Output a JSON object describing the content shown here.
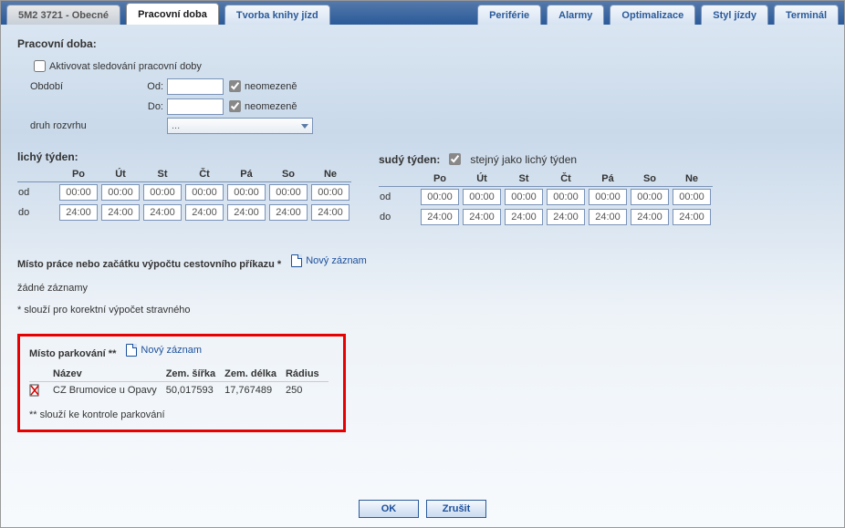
{
  "tabs": [
    {
      "label": "5M2 3721 - Obecné"
    },
    {
      "label": "Pracovní doba"
    },
    {
      "label": "Tvorba knihy jízd"
    },
    {
      "label": "Periférie"
    },
    {
      "label": "Alarmy"
    },
    {
      "label": "Optimalizace"
    },
    {
      "label": "Styl jízdy"
    },
    {
      "label": "Terminál"
    }
  ],
  "workhours": {
    "heading": "Pracovní doba:",
    "activate_label": "Aktivovat sledování pracovní doby",
    "period_label": "Období",
    "from_label": "Od:",
    "to_label": "Do:",
    "from_value": "",
    "to_value": "",
    "unlimited_label": "neomezeně",
    "schedule_type_label": "druh rozvrhu",
    "schedule_type_value": "..."
  },
  "odd_week": {
    "title": "lichý týden:",
    "days": [
      "Po",
      "Út",
      "St",
      "Čt",
      "Pá",
      "So",
      "Ne"
    ],
    "row_od": "od",
    "row_do": "do",
    "od": [
      "00:00",
      "00:00",
      "00:00",
      "00:00",
      "00:00",
      "00:00",
      "00:00"
    ],
    "do": [
      "24:00",
      "24:00",
      "24:00",
      "24:00",
      "24:00",
      "24:00",
      "24:00"
    ]
  },
  "even_week": {
    "title": "sudý týden:",
    "same_label": "stejný jako lichý týden",
    "days": [
      "Po",
      "Út",
      "St",
      "Čt",
      "Pá",
      "So",
      "Ne"
    ],
    "row_od": "od",
    "row_do": "do",
    "od": [
      "00:00",
      "00:00",
      "00:00",
      "00:00",
      "00:00",
      "00:00",
      "00:00"
    ],
    "do": [
      "24:00",
      "24:00",
      "24:00",
      "24:00",
      "24:00",
      "24:00",
      "24:00"
    ]
  },
  "workplace": {
    "heading": "Místo práce nebo začátku výpočtu cestovního příkazu *",
    "new_link": "Nový záznam",
    "empty": "žádné záznamy",
    "note": "* slouží pro korektní výpočet stravného"
  },
  "parking": {
    "heading": "Místo parkování **",
    "new_link": "Nový záznam",
    "columns": {
      "name": "Název",
      "lat": "Zem. šířka",
      "lon": "Zem. délka",
      "radius": "Rádius"
    },
    "rows": [
      {
        "name": "CZ Brumovice u Opavy",
        "lat": "50,017593",
        "lon": "17,767489",
        "radius": "250"
      }
    ],
    "note": "** slouží ke kontrole parkování"
  },
  "buttons": {
    "ok": "OK",
    "cancel": "Zrušit"
  }
}
